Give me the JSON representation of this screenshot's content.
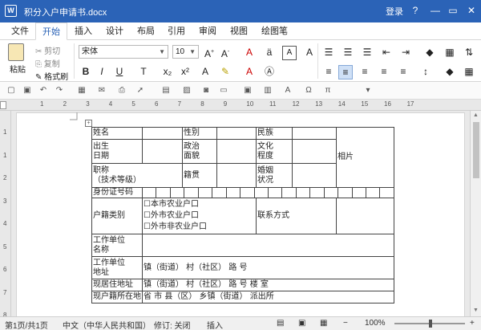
{
  "window": {
    "title": "积分入户申请书.docx",
    "app_letter": "W",
    "login": "登录",
    "help": "?",
    "minimize": "—",
    "restore": "▭",
    "close": "✕"
  },
  "tabs": [
    "文件",
    "开始",
    "插入",
    "设计",
    "布局",
    "引用",
    "审阅",
    "视图",
    "绘图笔"
  ],
  "ribbon": {
    "paste": "粘贴",
    "cut": "剪切",
    "copy": "复制",
    "format_painter": "格式刷",
    "font_name": "宋体",
    "font_size": "10"
  },
  "ruler_numbers": [
    "1",
    "2",
    "3",
    "4",
    "5",
    "6",
    "7",
    "8",
    "9",
    "10",
    "11",
    "12",
    "13",
    "14",
    "15",
    "16",
    "17"
  ],
  "vruler_numbers": [
    "1",
    "1",
    "2",
    "3",
    "4",
    "5",
    "6",
    "7",
    "8"
  ],
  "form": {
    "r1": [
      "姓名",
      "性别",
      "民族"
    ],
    "r2": [
      "出生",
      "日期",
      "政治",
      "面貌",
      "文化",
      "程度",
      "相片"
    ],
    "r3": [
      "职称",
      "（技术等级）",
      "籍贯",
      "婚姻",
      "状况"
    ],
    "id_label": "身份证号码",
    "hukou_label": "户籍类别",
    "hukou_options": [
      "☐本市农业户口",
      "☐外市农业户口",
      "☐外市非农业户口"
    ],
    "contact_label": "联系方式",
    "employer_label": [
      "工作单位",
      "名称"
    ],
    "employer_addr_label": [
      "工作单位",
      "地址"
    ],
    "employer_addr_value": "镇（街道） 村（社区） 路 号",
    "current_addr_label": "现居住地址",
    "current_addr_value": "镇（街道） 村（社区） 路 号 楼 室",
    "orig_addr_label": "现户籍所在地",
    "orig_addr_value": "省 市 县（区） 乡镇（街道） 派出所"
  },
  "status": {
    "page": "第1页/共1页",
    "language": "中文（中华人民共和国）",
    "track": "修订: 关闭",
    "mode": "插入",
    "zoom": "100%"
  }
}
